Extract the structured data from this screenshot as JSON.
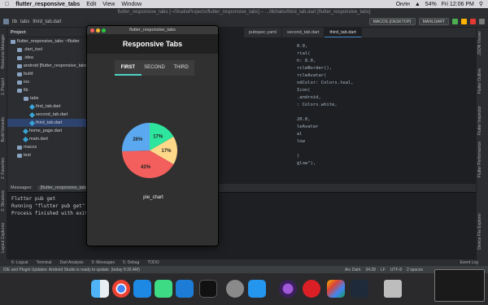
{
  "menubar": {
    "app_name": "flutter_responsive_tabs",
    "menus": [
      "Edit",
      "View",
      "Window"
    ],
    "battery": "54%",
    "clock": "Fri 12:06 PM",
    "network": "Онлн"
  },
  "ide": {
    "title": "flutter_responsive_tabs [~/StudioProjects/flutter_responsive_tabs] – .../lib/tabs/third_tab.dart [flutter_responsive_tabs]",
    "breadcrumb": [
      "lib",
      "tabs",
      "third_tab.dart"
    ],
    "device": "MACOS (DESKTOP)",
    "run_config": "MAIN.DART"
  },
  "editor_tabs": [
    "pubspec.yaml",
    "second_tab.dart",
    "third_tab.dart"
  ],
  "project_panel": {
    "title": "Project",
    "items": [
      {
        "label": "flutter_responsive_tabs ~/flutter",
        "indent": 0,
        "icon": "folder-icon"
      },
      {
        "label": ".dart_tool",
        "indent": 1,
        "icon": "folder-icon"
      },
      {
        "label": ".idea",
        "indent": 1,
        "icon": "folder-icon"
      },
      {
        "label": "android [flutter_responsive_tabs",
        "indent": 1,
        "icon": "folder-icon"
      },
      {
        "label": "build",
        "indent": 1,
        "icon": "folder-icon"
      },
      {
        "label": "ios",
        "indent": 1,
        "icon": "folder-icon"
      },
      {
        "label": "lib",
        "indent": 1,
        "icon": "folder-icon"
      },
      {
        "label": "tabs",
        "indent": 2,
        "icon": "folder-icon"
      },
      {
        "label": "first_tab.dart",
        "indent": 3,
        "icon": "dart-icon"
      },
      {
        "label": "second_tab.dart",
        "indent": 3,
        "icon": "dart-icon"
      },
      {
        "label": "third_tab.dart",
        "indent": 3,
        "icon": "dart-icon",
        "selected": true
      },
      {
        "label": "home_page.dart",
        "indent": 2,
        "icon": "dart-icon"
      },
      {
        "label": "main.dart",
        "indent": 2,
        "icon": "dart-icon"
      },
      {
        "label": "macos",
        "indent": 1,
        "icon": "folder-icon"
      },
      {
        "label": "test",
        "indent": 1,
        "icon": "folder-icon"
      }
    ]
  },
  "code_lines": [
    "0.0,",
    "rial(",
    "h: 8.0,",
    "rcleBorder(),",
    "rcleAvatar(",
    "ndColor: Colors.teal,",
    "Icon(",
    ".android,",
    ": Colors.white,",
    "",
    "20.0,",
    "leAvatar",
    "al",
    "low",
    "",
    ")",
    "glow\"),",
    ""
  ],
  "left_strip_labels": [
    "Resource Manager",
    "1: Project",
    "Build Variants",
    "2: Favorites",
    "2: Structure",
    "Layout Captures"
  ],
  "right_strip_labels": [
    "JSON Viewer",
    "Flutter Outline",
    "Flutter Inspector",
    "Flutter Performance",
    "Device File Explorer"
  ],
  "messages": {
    "label": "Messages:",
    "tab": "[flutter_responsive_tabs]",
    "lines": [
      "Flutter pub get",
      "Running \"flutter pub get\" in flutter_responsive_tabs...",
      "Process finished with exit code 0"
    ]
  },
  "bottom_tools": [
    "6: Logcat",
    "Terminal",
    "Dart Analysis",
    "0: Messages",
    "5: Debug",
    "TODO"
  ],
  "event_log": "Event Log",
  "status": {
    "message": "IDE and Plugin Updates: Android Studio is ready to update. (today 9:35 AM)",
    "theme": "Arc Dark",
    "position": "34:28",
    "line_sep": "LF",
    "encoding": "UTF-8",
    "indent": "2 spaces"
  },
  "flutter_app": {
    "window_title": "flutter_responsive_tabs",
    "appbar_title": "Responsive Tabs",
    "tabs": [
      "FIRST",
      "SECOND",
      "THIRD"
    ],
    "active_tab": 0,
    "pie_label": "pie_chart"
  },
  "chart_data": {
    "type": "pie",
    "slices": [
      {
        "label": "17%",
        "value": 17,
        "color": "#FFD88A"
      },
      {
        "label": "42%",
        "value": 42,
        "color": "#F25F5C"
      },
      {
        "label": "26%",
        "value": 26,
        "color": "#5AA9F0"
      },
      {
        "label": "17%",
        "value": 17,
        "color": "#2EE59D"
      }
    ],
    "start_angle_deg": -30
  },
  "dock_icons": [
    "finder-icon",
    "launchpad-icon",
    "chrome-icon",
    "vscode-icon",
    "android-studio-icon",
    "xcode-icon",
    "terminal-icon",
    "system-preferences-icon",
    "docker-icon",
    "tor-browser-icon",
    "creative-cloud-icon",
    "photos-icon",
    "flutter-icon",
    "trash-icon"
  ]
}
